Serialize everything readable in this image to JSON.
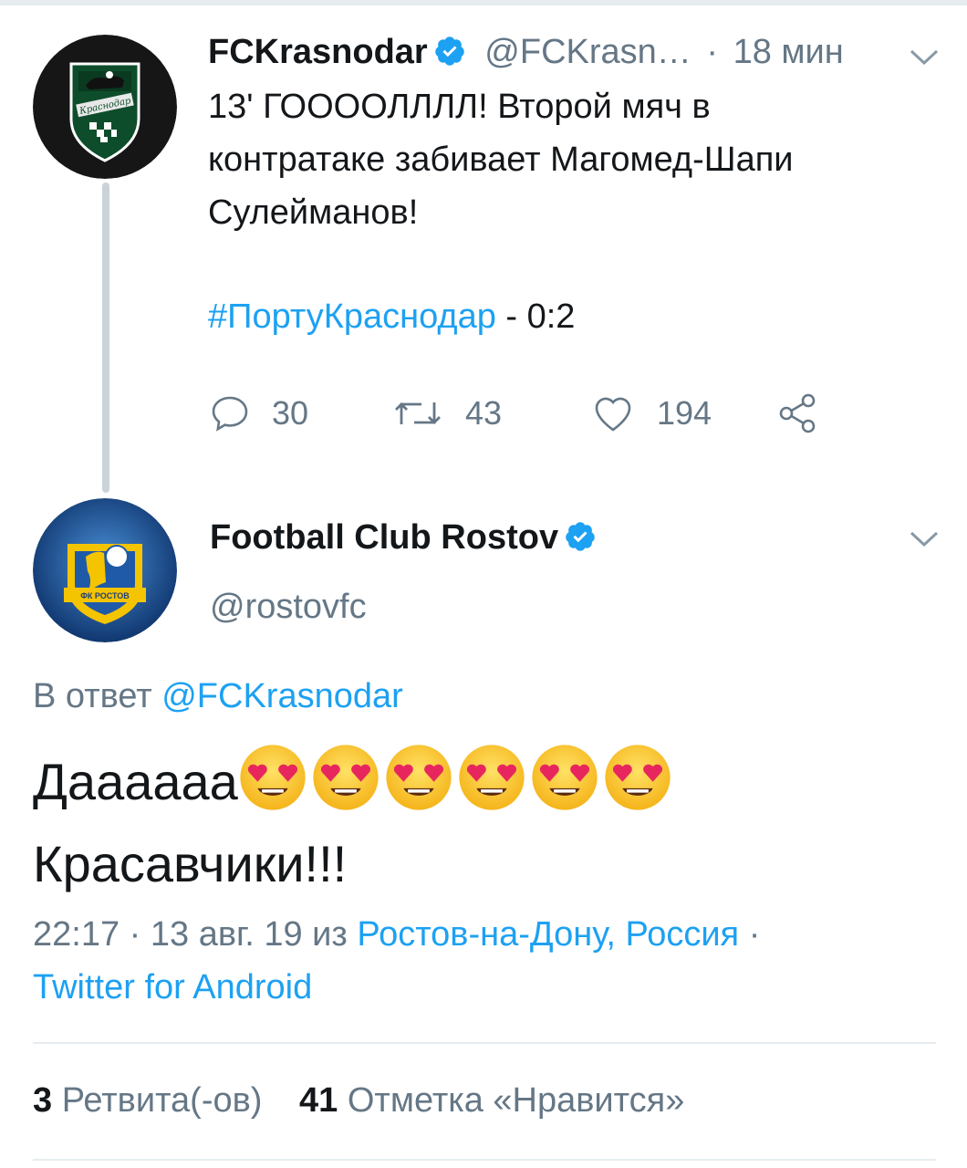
{
  "tweet1": {
    "display_name": "FCKrasnodar",
    "handle": "@FCKrasn…",
    "separator": "·",
    "time": "18 мин",
    "text_lines": [
      "13' ГООООЛЛЛЛ! Второй мяч в",
      "контратаке забивает Магомед-Шапи",
      "Сулейманов!"
    ],
    "hashtag": "#ПортуКраснодар",
    "score": " - 0:2",
    "reply_count": "30",
    "retweet_count": "43",
    "like_count": "194",
    "avatar_text": "Краснодар"
  },
  "tweet2": {
    "display_name": "Football Club Rostov",
    "handle": "@rostovfc",
    "reply_prefix": "В ответ",
    "reply_handle": "@FCKrasnodar",
    "text_line1": "Даааааа",
    "text_line2": "Красавчики!!!",
    "emoji_count": 6,
    "emoji_name": "smiling-face-with-heart-eyes",
    "date": "22:17 · 13 авг. 19 из",
    "location": "Ростов-на-Дону, Россия",
    "meta_separator": " ·",
    "source": "Twitter for Android",
    "avatar_text": "ФК РОСТОВ"
  },
  "stats": {
    "retweets_value": "3",
    "retweets_label": "Ретвита(-ов)",
    "likes_value": "41",
    "likes_label": "Отметка «Нравится»"
  },
  "colors": {
    "link": "#1da1f2",
    "muted": "#657786",
    "text": "#14171a",
    "krasnodar_green": "#0d4d2b",
    "rostov_blue": "#1f5aa8",
    "rostov_yellow": "#f5c400"
  }
}
